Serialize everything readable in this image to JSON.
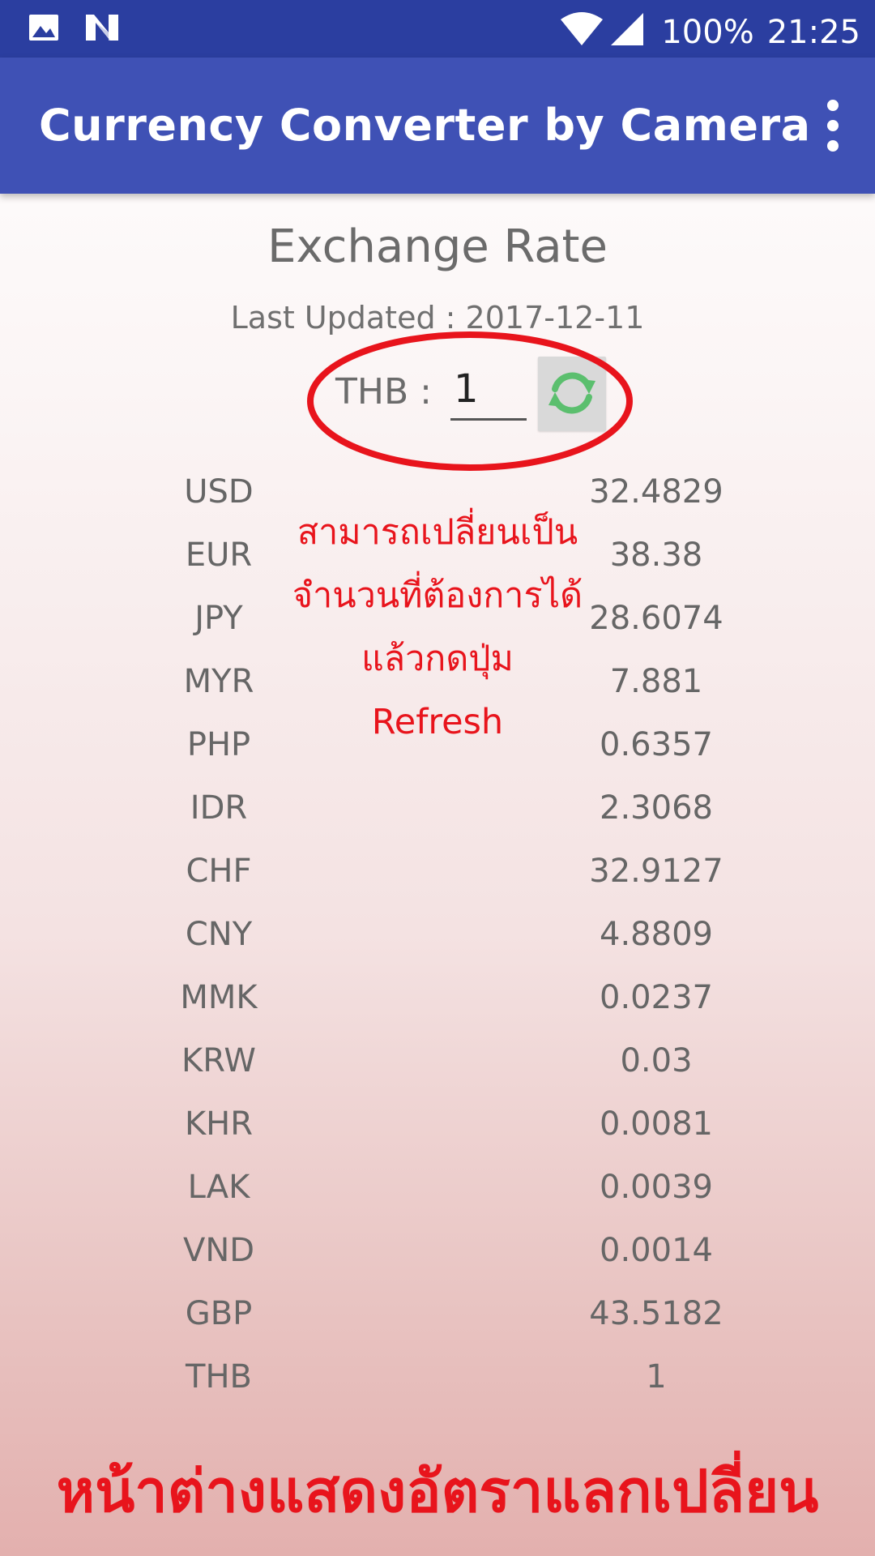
{
  "status_bar": {
    "battery": "100%",
    "time": "21:25"
  },
  "app_bar": {
    "title": "Currency Converter by Camera"
  },
  "heading": "Exchange Rate",
  "last_updated": "Last Updated : 2017-12-11",
  "amount": {
    "label": "THB :",
    "value": "1"
  },
  "rates": [
    {
      "code": "USD",
      "value": "32.4829"
    },
    {
      "code": "EUR",
      "value": "38.38"
    },
    {
      "code": "JPY",
      "value": "28.6074"
    },
    {
      "code": "MYR",
      "value": "7.881"
    },
    {
      "code": "PHP",
      "value": "0.6357"
    },
    {
      "code": "IDR",
      "value": "2.3068"
    },
    {
      "code": "CHF",
      "value": "32.9127"
    },
    {
      "code": "CNY",
      "value": "4.8809"
    },
    {
      "code": "MMK",
      "value": "0.0237"
    },
    {
      "code": "KRW",
      "value": "0.03"
    },
    {
      "code": "KHR",
      "value": "0.0081"
    },
    {
      "code": "LAK",
      "value": "0.0039"
    },
    {
      "code": "VND",
      "value": "0.0014"
    },
    {
      "code": "GBP",
      "value": "43.5182"
    },
    {
      "code": "THB",
      "value": "1"
    }
  ],
  "annotation": {
    "lines": [
      "สามารถเปลี่ยนเป็น",
      "จำนวนที่ต้องการได้",
      "แล้วกดปุ่ม",
      "Refresh"
    ]
  },
  "caption": "หน้าต่างแสดงอัตราแลกเปลี่ยน",
  "colors": {
    "status_bar": "#2b3ea0",
    "app_bar": "#3f51b5",
    "annotation_red": "#e8141c",
    "refresh_icon": "#5bbf6e"
  },
  "icons": {
    "status_left": [
      "image-icon",
      "n-logo-icon"
    ],
    "status_right": [
      "wifi-icon",
      "signal-icon"
    ],
    "refresh": "refresh-icon",
    "menu": "more-vert-icon"
  }
}
